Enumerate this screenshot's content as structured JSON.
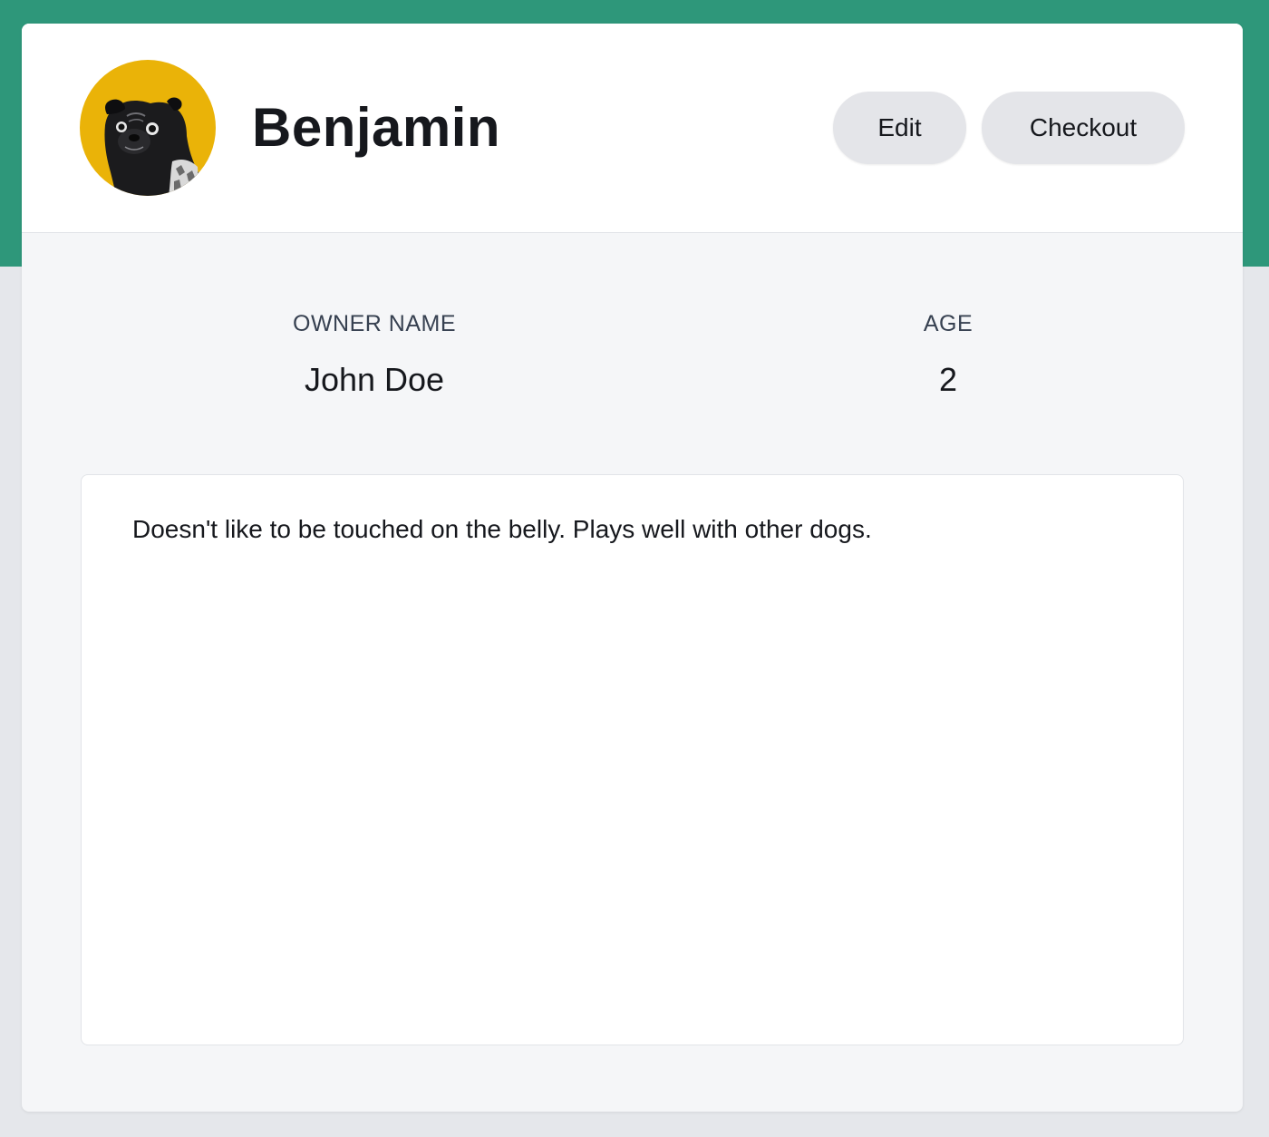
{
  "pet": {
    "name": "Benjamin",
    "avatar_icon": "pug-photo",
    "avatar_bg": "#eab308"
  },
  "actions": {
    "edit_label": "Edit",
    "checkout_label": "Checkout"
  },
  "details": {
    "owner_label": "OWNER NAME",
    "owner_value": "John Doe",
    "age_label": "AGE",
    "age_value": "2"
  },
  "notes": {
    "text": "Doesn't like to be touched on the belly. Plays well with other dogs."
  },
  "theme": {
    "header_band": "#2e977a",
    "page_bg": "#e5e7eb",
    "button_bg": "#e4e5e9"
  }
}
